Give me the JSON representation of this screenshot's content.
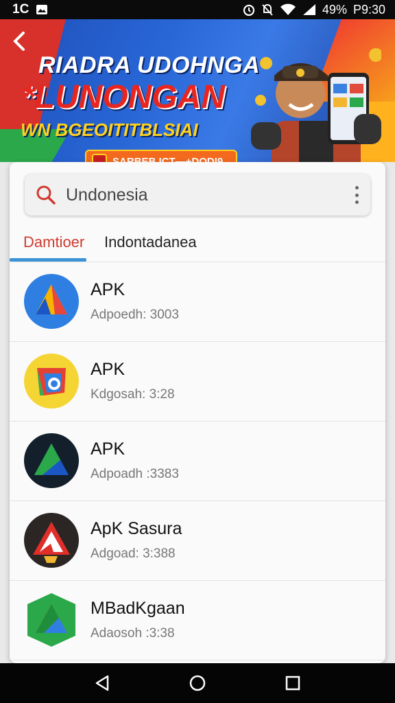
{
  "status_bar": {
    "time": "1C",
    "battery": "49%",
    "right_text": "P9:30",
    "icons": [
      "gallery-icon",
      "alarm-icon",
      "mute-icon",
      "wifi-icon",
      "signal-icon"
    ]
  },
  "banner": {
    "title_line1": "RIADRA UDOHNGA",
    "title_line2": "*LUNONGAN",
    "title_line3": "WN BGEOITITBLSIAI",
    "pill_text": "SARBEB ICT—+DODI9",
    "colors": {
      "blue": "#2866d6",
      "red": "#e8261f",
      "yellow": "#ffd21f",
      "orange": "#f36a1e"
    }
  },
  "search": {
    "value": "Undonesia",
    "icon": "search-icon"
  },
  "tabs": [
    {
      "label": "Damtioer",
      "active": true
    },
    {
      "label": "Indontadanea",
      "active": false
    }
  ],
  "apps": [
    {
      "name": "APK",
      "subtitle": "Adpoedh: 3003",
      "icon": "app-triangle-blue-icon"
    },
    {
      "name": "APK",
      "subtitle": "Kdgosah: 3:28",
      "icon": "app-triangle-yellow-icon"
    },
    {
      "name": "APK",
      "subtitle": "Adpoadh :3383",
      "icon": "app-triangle-dark-icon"
    },
    {
      "name": "ApK Sasura",
      "subtitle": "Adgoad: 3:388",
      "icon": "app-triangle-red-icon"
    },
    {
      "name": "MBadKgaan",
      "subtitle": "Adaosoh :3:38",
      "icon": "app-triangle-green-icon"
    }
  ],
  "navigation": [
    "back-icon",
    "home-icon",
    "recents-icon"
  ]
}
